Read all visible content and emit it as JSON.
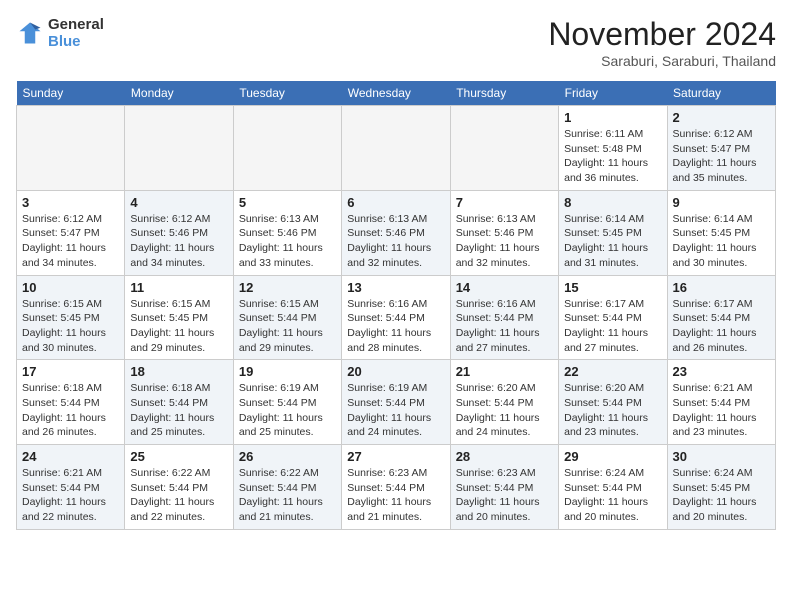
{
  "header": {
    "logo_line1": "General",
    "logo_line2": "Blue",
    "month_title": "November 2024",
    "subtitle": "Saraburi, Saraburi, Thailand"
  },
  "days_of_week": [
    "Sunday",
    "Monday",
    "Tuesday",
    "Wednesday",
    "Thursday",
    "Friday",
    "Saturday"
  ],
  "weeks": [
    [
      {
        "day": "",
        "info": "",
        "empty": true
      },
      {
        "day": "",
        "info": "",
        "empty": true
      },
      {
        "day": "",
        "info": "",
        "empty": true
      },
      {
        "day": "",
        "info": "",
        "empty": true
      },
      {
        "day": "",
        "info": "",
        "empty": true
      },
      {
        "day": "1",
        "info": "Sunrise: 6:11 AM\nSunset: 5:48 PM\nDaylight: 11 hours\nand 36 minutes.",
        "empty": false,
        "shaded": false
      },
      {
        "day": "2",
        "info": "Sunrise: 6:12 AM\nSunset: 5:47 PM\nDaylight: 11 hours\nand 35 minutes.",
        "empty": false,
        "shaded": true
      }
    ],
    [
      {
        "day": "3",
        "info": "Sunrise: 6:12 AM\nSunset: 5:47 PM\nDaylight: 11 hours\nand 34 minutes.",
        "empty": false,
        "shaded": false
      },
      {
        "day": "4",
        "info": "Sunrise: 6:12 AM\nSunset: 5:46 PM\nDaylight: 11 hours\nand 34 minutes.",
        "empty": false,
        "shaded": true
      },
      {
        "day": "5",
        "info": "Sunrise: 6:13 AM\nSunset: 5:46 PM\nDaylight: 11 hours\nand 33 minutes.",
        "empty": false,
        "shaded": false
      },
      {
        "day": "6",
        "info": "Sunrise: 6:13 AM\nSunset: 5:46 PM\nDaylight: 11 hours\nand 32 minutes.",
        "empty": false,
        "shaded": true
      },
      {
        "day": "7",
        "info": "Sunrise: 6:13 AM\nSunset: 5:46 PM\nDaylight: 11 hours\nand 32 minutes.",
        "empty": false,
        "shaded": false
      },
      {
        "day": "8",
        "info": "Sunrise: 6:14 AM\nSunset: 5:45 PM\nDaylight: 11 hours\nand 31 minutes.",
        "empty": false,
        "shaded": true
      },
      {
        "day": "9",
        "info": "Sunrise: 6:14 AM\nSunset: 5:45 PM\nDaylight: 11 hours\nand 30 minutes.",
        "empty": false,
        "shaded": false
      }
    ],
    [
      {
        "day": "10",
        "info": "Sunrise: 6:15 AM\nSunset: 5:45 PM\nDaylight: 11 hours\nand 30 minutes.",
        "empty": false,
        "shaded": true
      },
      {
        "day": "11",
        "info": "Sunrise: 6:15 AM\nSunset: 5:45 PM\nDaylight: 11 hours\nand 29 minutes.",
        "empty": false,
        "shaded": false
      },
      {
        "day": "12",
        "info": "Sunrise: 6:15 AM\nSunset: 5:44 PM\nDaylight: 11 hours\nand 29 minutes.",
        "empty": false,
        "shaded": true
      },
      {
        "day": "13",
        "info": "Sunrise: 6:16 AM\nSunset: 5:44 PM\nDaylight: 11 hours\nand 28 minutes.",
        "empty": false,
        "shaded": false
      },
      {
        "day": "14",
        "info": "Sunrise: 6:16 AM\nSunset: 5:44 PM\nDaylight: 11 hours\nand 27 minutes.",
        "empty": false,
        "shaded": true
      },
      {
        "day": "15",
        "info": "Sunrise: 6:17 AM\nSunset: 5:44 PM\nDaylight: 11 hours\nand 27 minutes.",
        "empty": false,
        "shaded": false
      },
      {
        "day": "16",
        "info": "Sunrise: 6:17 AM\nSunset: 5:44 PM\nDaylight: 11 hours\nand 26 minutes.",
        "empty": false,
        "shaded": true
      }
    ],
    [
      {
        "day": "17",
        "info": "Sunrise: 6:18 AM\nSunset: 5:44 PM\nDaylight: 11 hours\nand 26 minutes.",
        "empty": false,
        "shaded": false
      },
      {
        "day": "18",
        "info": "Sunrise: 6:18 AM\nSunset: 5:44 PM\nDaylight: 11 hours\nand 25 minutes.",
        "empty": false,
        "shaded": true
      },
      {
        "day": "19",
        "info": "Sunrise: 6:19 AM\nSunset: 5:44 PM\nDaylight: 11 hours\nand 25 minutes.",
        "empty": false,
        "shaded": false
      },
      {
        "day": "20",
        "info": "Sunrise: 6:19 AM\nSunset: 5:44 PM\nDaylight: 11 hours\nand 24 minutes.",
        "empty": false,
        "shaded": true
      },
      {
        "day": "21",
        "info": "Sunrise: 6:20 AM\nSunset: 5:44 PM\nDaylight: 11 hours\nand 24 minutes.",
        "empty": false,
        "shaded": false
      },
      {
        "day": "22",
        "info": "Sunrise: 6:20 AM\nSunset: 5:44 PM\nDaylight: 11 hours\nand 23 minutes.",
        "empty": false,
        "shaded": true
      },
      {
        "day": "23",
        "info": "Sunrise: 6:21 AM\nSunset: 5:44 PM\nDaylight: 11 hours\nand 23 minutes.",
        "empty": false,
        "shaded": false
      }
    ],
    [
      {
        "day": "24",
        "info": "Sunrise: 6:21 AM\nSunset: 5:44 PM\nDaylight: 11 hours\nand 22 minutes.",
        "empty": false,
        "shaded": true
      },
      {
        "day": "25",
        "info": "Sunrise: 6:22 AM\nSunset: 5:44 PM\nDaylight: 11 hours\nand 22 minutes.",
        "empty": false,
        "shaded": false
      },
      {
        "day": "26",
        "info": "Sunrise: 6:22 AM\nSunset: 5:44 PM\nDaylight: 11 hours\nand 21 minutes.",
        "empty": false,
        "shaded": true
      },
      {
        "day": "27",
        "info": "Sunrise: 6:23 AM\nSunset: 5:44 PM\nDaylight: 11 hours\nand 21 minutes.",
        "empty": false,
        "shaded": false
      },
      {
        "day": "28",
        "info": "Sunrise: 6:23 AM\nSunset: 5:44 PM\nDaylight: 11 hours\nand 20 minutes.",
        "empty": false,
        "shaded": true
      },
      {
        "day": "29",
        "info": "Sunrise: 6:24 AM\nSunset: 5:44 PM\nDaylight: 11 hours\nand 20 minutes.",
        "empty": false,
        "shaded": false
      },
      {
        "day": "30",
        "info": "Sunrise: 6:24 AM\nSunset: 5:45 PM\nDaylight: 11 hours\nand 20 minutes.",
        "empty": false,
        "shaded": true
      }
    ]
  ]
}
